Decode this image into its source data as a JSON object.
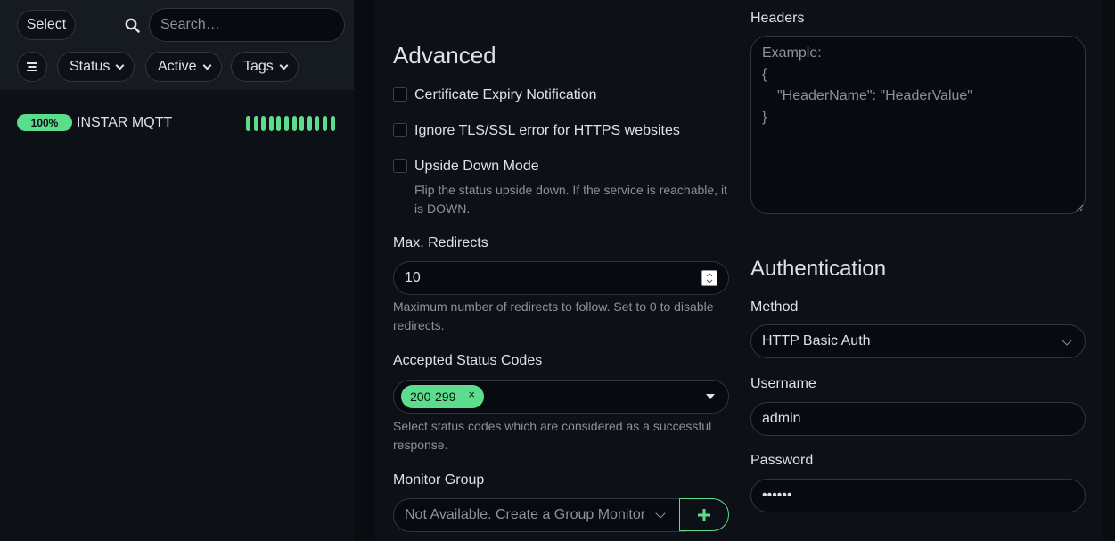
{
  "sidebar": {
    "select_label": "Select",
    "search_placeholder": "Search…",
    "filters": [
      {
        "label": "Status"
      },
      {
        "label": "Active"
      },
      {
        "label": "Tags"
      }
    ],
    "monitors": [
      {
        "uptime": "100%",
        "name": "INSTAR MQTT",
        "heartbeats": 12,
        "heartbeat_color": "#5cdd8b"
      }
    ]
  },
  "advanced": {
    "title": "Advanced",
    "checkboxes": [
      {
        "label": "Certificate Expiry Notification",
        "checked": false
      },
      {
        "label": "Ignore TLS/SSL error for HTTPS websites",
        "checked": false
      },
      {
        "label": "Upside Down Mode",
        "checked": false
      }
    ],
    "upside_down_help_1": "Flip the status upside down. If the service is reachable, it",
    "upside_down_help_2": "is DOWN.",
    "max_redirects_label": "Max. Redirects",
    "max_redirects_value": "10",
    "max_redirects_help_1": "Maximum number of redirects to follow. Set to 0 to disable",
    "max_redirects_help_2": "redirects.",
    "accepted_codes_label": "Accepted Status Codes",
    "accepted_codes_tags": [
      "200-299"
    ],
    "accepted_codes_help_1": "Select status codes which are considered as a successful",
    "accepted_codes_help_2": "response.",
    "monitor_group_label": "Monitor Group",
    "monitor_group_value": "Not Available. Create a Group Monitor",
    "add_button_label": "+"
  },
  "headers": {
    "label": "Headers",
    "placeholder_lines": [
      "Example:",
      "{",
      "\"HeaderName\": \"HeaderValue\"",
      "}"
    ]
  },
  "authentication": {
    "title": "Authentication",
    "method_label": "Method",
    "method_value": "HTTP Basic Auth",
    "username_label": "Username",
    "username_value": "admin",
    "password_label": "Password",
    "password_value": "••••••"
  },
  "colors": {
    "accent": "#5cdd8b",
    "background": "#090c10",
    "panel": "#0d1117"
  }
}
